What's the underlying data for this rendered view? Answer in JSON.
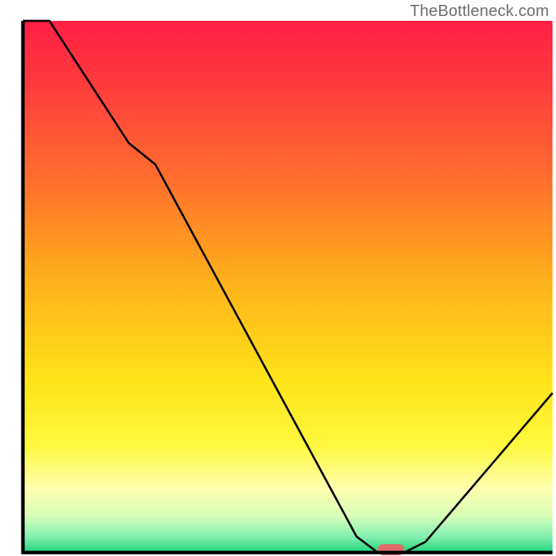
{
  "watermark_text": "TheBottleneck.com",
  "chart_data": {
    "type": "line",
    "title": "",
    "xlabel": "",
    "ylabel": "",
    "xlim": [
      0,
      100
    ],
    "ylim": [
      0,
      100
    ],
    "x": [
      0,
      5,
      20,
      25,
      63,
      67,
      72,
      76,
      100
    ],
    "values": [
      100,
      100,
      77,
      73,
      3,
      0,
      0,
      2,
      30
    ],
    "marker": {
      "x_start": 67,
      "x_end": 72,
      "y": 0
    },
    "gradient_stops": [
      {
        "offset": 0.0,
        "color": "#ff1f44"
      },
      {
        "offset": 0.12,
        "color": "#ff3b3d"
      },
      {
        "offset": 0.3,
        "color": "#ff6f2d"
      },
      {
        "offset": 0.5,
        "color": "#ffb41a"
      },
      {
        "offset": 0.68,
        "color": "#ffe41a"
      },
      {
        "offset": 0.8,
        "color": "#fff93f"
      },
      {
        "offset": 0.88,
        "color": "#ffffb0"
      },
      {
        "offset": 0.93,
        "color": "#d8ffb8"
      },
      {
        "offset": 0.97,
        "color": "#84f0b0"
      },
      {
        "offset": 1.0,
        "color": "#1ed47a"
      }
    ]
  }
}
